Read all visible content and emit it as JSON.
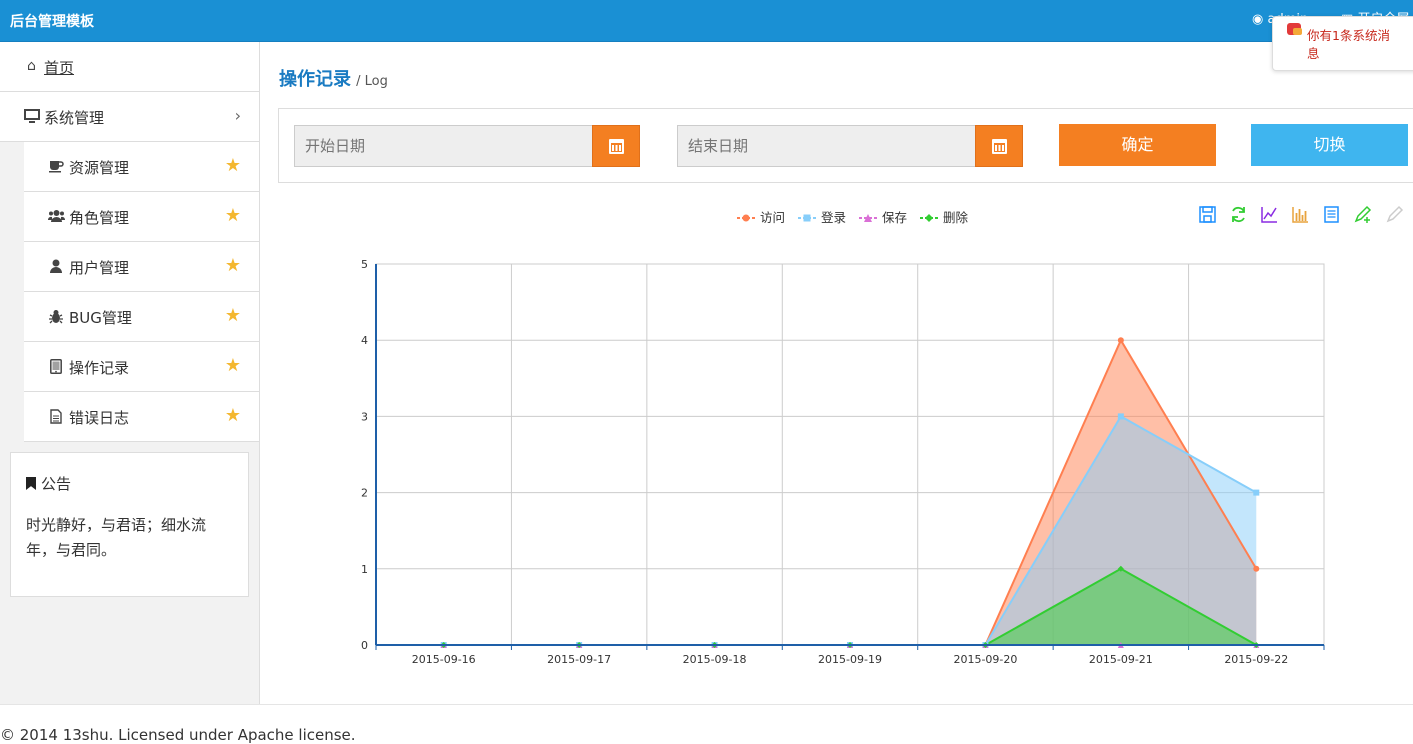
{
  "header": {
    "brand": "后台管理模板",
    "user": "admin",
    "fullscreen": "开启全屏"
  },
  "notification": {
    "text": "你有1条系统消息"
  },
  "sidebar": {
    "home": "首页",
    "system": "系统管理",
    "items": [
      {
        "label": "资源管理",
        "icon": "coffee-icon"
      },
      {
        "label": "角色管理",
        "icon": "users-icon"
      },
      {
        "label": "用户管理",
        "icon": "user-icon"
      },
      {
        "label": "BUG管理",
        "icon": "bug-icon"
      },
      {
        "label": "操作记录",
        "icon": "tablet-icon"
      },
      {
        "label": "错误日志",
        "icon": "file-icon"
      }
    ],
    "notice": {
      "title": "公告",
      "body": "时光静好，与君语；细水流年，与君同。"
    }
  },
  "page": {
    "title": "操作记录",
    "subtitle": "/ Log"
  },
  "filter": {
    "start_placeholder": "开始日期",
    "end_placeholder": "结束日期",
    "confirm": "确定",
    "switch": "切换"
  },
  "colors": {
    "primary": "#1a90d4",
    "orange": "#f47f21",
    "light_blue": "#3fb5ef",
    "visit": "#ff7f50",
    "login": "#87cefa",
    "save": "#da70d6",
    "delete": "#32cd32"
  },
  "chart_data": {
    "type": "area",
    "categories": [
      "2015-09-16",
      "2015-09-17",
      "2015-09-18",
      "2015-09-19",
      "2015-09-20",
      "2015-09-21",
      "2015-09-22"
    ],
    "ylim": [
      0,
      5
    ],
    "yticks": [
      "0",
      "1",
      "2",
      "3",
      "4",
      "5"
    ],
    "grid": true,
    "legend_position": "top-center",
    "series": [
      {
        "name": "访问",
        "color": "#ff7f50",
        "marker": "circle",
        "values": [
          0,
          0,
          0,
          0,
          0,
          4,
          1
        ]
      },
      {
        "name": "登录",
        "color": "#87cefa",
        "marker": "square",
        "values": [
          0,
          0,
          0,
          0,
          0,
          3,
          2
        ]
      },
      {
        "name": "保存",
        "color": "#da70d6",
        "marker": "triangle",
        "values": [
          0,
          0,
          0,
          0,
          0,
          0,
          0
        ]
      },
      {
        "name": "删除",
        "color": "#32cd32",
        "marker": "diamond",
        "values": [
          0,
          0,
          0,
          0,
          0,
          1,
          0
        ]
      }
    ]
  },
  "footer": {
    "text": "© 2014 13shu. Licensed under Apache license."
  }
}
